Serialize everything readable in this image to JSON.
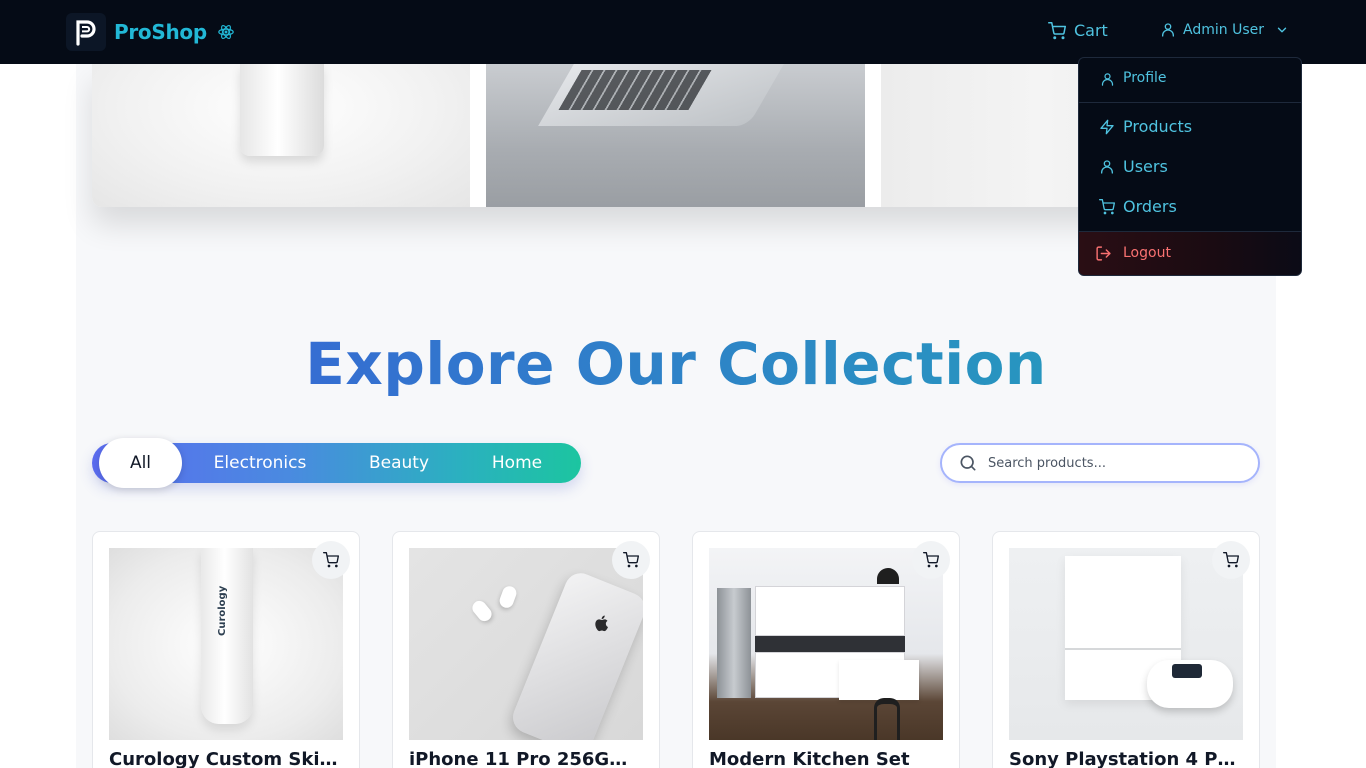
{
  "brand": {
    "name": "ProShop",
    "logo_letter": "P"
  },
  "nav": {
    "cart_label": "Cart",
    "user_label": "Admin User"
  },
  "dropdown": {
    "profile": "Profile",
    "products": "Products",
    "users": "Users",
    "orders": "Orders",
    "logout": "Logout"
  },
  "main": {
    "title": "Explore Our Collection",
    "filters": [
      "All",
      "Electronics",
      "Beauty",
      "Home"
    ],
    "active_filter": "All",
    "search_placeholder": "Search products..."
  },
  "products": [
    {
      "name": "Curology Custom Ski...",
      "image_text": "Curology"
    },
    {
      "name": "iPhone 11 Pro 256GB ..."
    },
    {
      "name": "Modern Kitchen Set"
    },
    {
      "name": "Sony Playstation 4 Pr..."
    }
  ],
  "colors": {
    "nav_bg": "#050b16",
    "accent": "#22b8d6",
    "logout": "#f87171",
    "title_gradient_start": "#3b5bdb",
    "title_gradient_end": "#22a6b8"
  },
  "icons": {
    "brand": "react-atom-icon",
    "cart": "cart-icon",
    "user": "user-icon",
    "products": "lightning-icon",
    "logout": "logout-icon",
    "search": "search-icon",
    "dropdown": "chevron-down-icon"
  }
}
